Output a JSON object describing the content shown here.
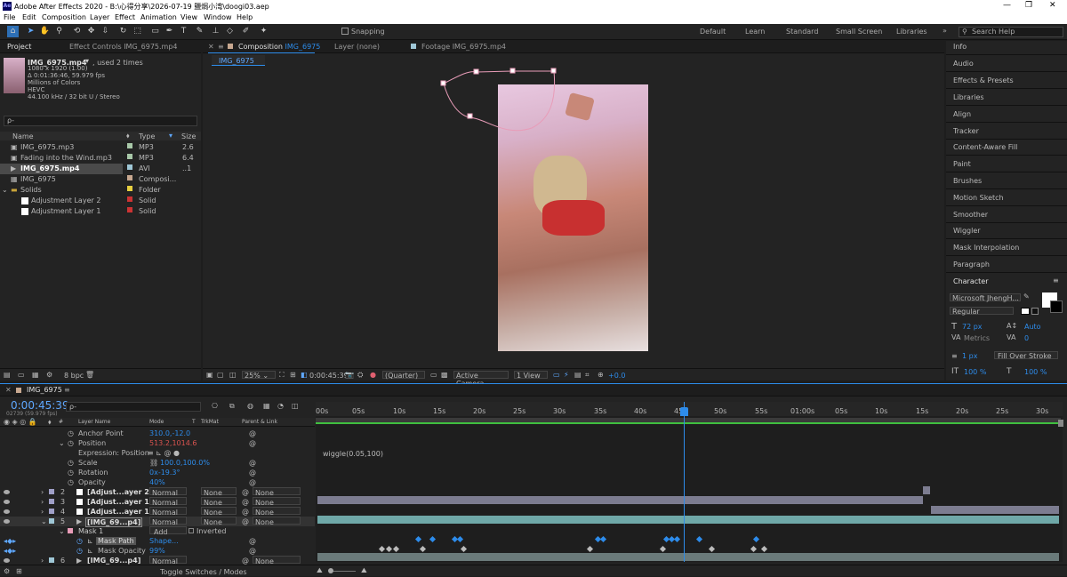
{
  "app": {
    "title": "Adobe After Effects 2020 - B:\\心得分享\\2026-07-19 鹽焗小湾\\doogi03.aep"
  },
  "menu": [
    "File",
    "Edit",
    "Composition",
    "Layer",
    "Effect",
    "Animation",
    "View",
    "Window",
    "Help"
  ],
  "toolbar": {
    "snapping": "Snapping",
    "workspaces": [
      "Default",
      "Learn",
      "Standard",
      "Small Screen",
      "Libraries"
    ],
    "search_placeholder": "Search Help"
  },
  "project": {
    "tab": "Project",
    "effect_controls_tab": "Effect Controls IMG_6975.mp4",
    "asset_name": "IMG_6975.mp4",
    "asset_used": ", used 2 times",
    "info_lines": [
      "1080 x 1920 (1.00)",
      "Δ 0:01:36:46, 59.979 fps",
      "Millions of Colors",
      "HEVC",
      "44.100 kHz / 32 bit U / Stereo"
    ],
    "search_placeholder": "ρ-",
    "col_name": "Name",
    "col_type": "Type",
    "col_size": "Size",
    "bpc": "8 bpc",
    "items": [
      {
        "name": "IMG_6975.mp3",
        "type": "MP3",
        "size": "2.6",
        "color": "#a8c8a8"
      },
      {
        "name": "Fading into the Wind.mp3",
        "type": "MP3",
        "size": "6.4",
        "color": "#a8c8a8"
      },
      {
        "name": "IMG_6975.mp4",
        "type": "AVI",
        "size": "..1",
        "color": "#9fc7d6"
      },
      {
        "name": "IMG_6975",
        "type": "Composi...",
        "size": "",
        "color": "#c8a890"
      },
      {
        "name": "Solids",
        "type": "Folder",
        "size": "",
        "color": "#e8d040"
      },
      {
        "name": "Adjustment Layer 2",
        "type": "Solid",
        "size": "",
        "color": "#cc3333"
      },
      {
        "name": "Adjustment Layer 1",
        "type": "Solid",
        "size": "",
        "color": "#cc3333"
      }
    ]
  },
  "viewer": {
    "comp_tab": "Composition",
    "comp_name": "IMG_6975",
    "layer_tab": "Layer (none)",
    "footage_tab": "Footage IMG_6975.mp4",
    "sub_tab": "IMG_6975",
    "zoom": "25%",
    "time": "0:00:45:39",
    "resolution": "(Quarter)",
    "camera": "Active Camera",
    "views": "1 View",
    "exposure": "+0.0"
  },
  "right_panels": [
    "Info",
    "Audio",
    "Effects & Presets",
    "Libraries",
    "Align",
    "Tracker",
    "Content-Aware Fill",
    "Paint",
    "Brushes",
    "Motion Sketch",
    "Smoother",
    "Wiggler",
    "Mask Interpolation",
    "Paragraph"
  ],
  "character": {
    "title": "Character",
    "font": "Microsoft JhengH...",
    "style": "Regular",
    "size": "72 px",
    "leading": "Auto",
    "kerning": "Metrics",
    "tracking": "0",
    "stroke": "1 px",
    "stroke_mode": "Fill Over Stroke",
    "vscale": "100 %",
    "hscale": "100 %"
  },
  "timeline": {
    "comp_tab": "IMG_6975",
    "time": "0:00:45:39",
    "frame": "02739 (59.979 fps)",
    "search_placeholder": "ρ-",
    "col_layer": "Layer Name",
    "col_mode": "Mode",
    "col_t": "T",
    "col_trkmat": "TrkMat",
    "col_parent": "Parent & Link",
    "toggle_label": "Toggle Switches / Modes",
    "ruler": [
      "00s",
      "05s",
      "10s",
      "15s",
      "20s",
      "25s",
      "30s",
      "35s",
      "40s",
      "45s",
      "50s",
      "55s",
      "01:00s",
      "05s",
      "10s",
      "15s",
      "20s",
      "25s",
      "30s"
    ],
    "props": [
      {
        "name": "Anchor Point",
        "value": "310.0,-12.0",
        "vcolor": "#2d8ceb"
      },
      {
        "name": "Position",
        "value": "513.2,1014.6",
        "vcolor": "#d9534f"
      },
      {
        "name": "Expression: Position",
        "value": "",
        "vcolor": "#2d8ceb"
      },
      {
        "name": "Scale",
        "value": "100.0,100.0%",
        "vcolor": "#2d8ceb"
      },
      {
        "name": "Rotation",
        "value": "0x-19.3°",
        "vcolor": "#2d8ceb"
      },
      {
        "name": "Opacity",
        "value": "40%",
        "vcolor": "#2d8ceb"
      }
    ],
    "expression": "wiggle(0.05,100)",
    "layers": [
      {
        "num": "2",
        "name": "[Adjust...ayer 2]",
        "mode": "Normal",
        "trkmat": "None",
        "parent": "None",
        "color": "#a0a0c8"
      },
      {
        "num": "3",
        "name": "[Adjust...ayer 1]",
        "mode": "Normal",
        "trkmat": "None",
        "parent": "None",
        "color": "#a0a0c8"
      },
      {
        "num": "4",
        "name": "[Adjust...ayer 1]",
        "mode": "Normal",
        "trkmat": "None",
        "parent": "None",
        "color": "#a0a0c8"
      },
      {
        "num": "5",
        "name": "[IMG_69...p4]",
        "mode": "Normal",
        "trkmat": "None",
        "parent": "None",
        "color": "#9fc7d6"
      }
    ],
    "mask": {
      "name": "Mask 1",
      "mode": "Add",
      "inverted": "Inverted",
      "path_label": "Mask Path",
      "path_value": "Shape...",
      "opacity_label": "Mask Opacity",
      "opacity_value": "99%"
    },
    "layer6": {
      "num": "6",
      "name": "[IMG_69...p4]",
      "mode": "Normal",
      "parent": "None",
      "color": "#9fc7d6"
    }
  }
}
